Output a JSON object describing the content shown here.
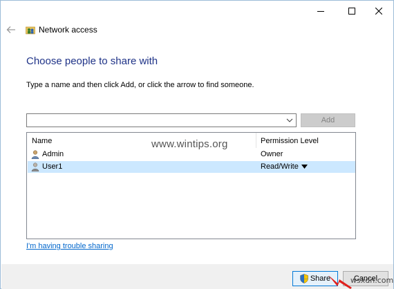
{
  "window": {
    "controls": {
      "minimize": "–",
      "maximize": "☐",
      "close": "✕"
    }
  },
  "header": {
    "back_icon": "back-arrow-icon",
    "app_icon": "network-folder-icon",
    "title": "Network access"
  },
  "main": {
    "heading": "Choose people to share with",
    "instruction": "Type a name and then click Add, or click the arrow to find someone.",
    "name_input": {
      "value": "",
      "placeholder": ""
    },
    "add_label": "Add",
    "list": {
      "columns": [
        "Name",
        "Permission Level"
      ],
      "rows": [
        {
          "name": "Admin",
          "permission": "Owner",
          "selected": false
        },
        {
          "name": "User1",
          "permission": "Read/Write",
          "selected": true
        }
      ]
    },
    "watermark": "www.wintips.org",
    "trouble_link": "I'm having trouble sharing"
  },
  "footer": {
    "share_label": "Share",
    "cancel_label": "Cancel",
    "corner_mark": "wsxdn.com"
  },
  "colors": {
    "heading": "#1e3287",
    "link": "#0066cc",
    "selection": "#cce8ff",
    "annotation_arrow": "#e0201d"
  }
}
